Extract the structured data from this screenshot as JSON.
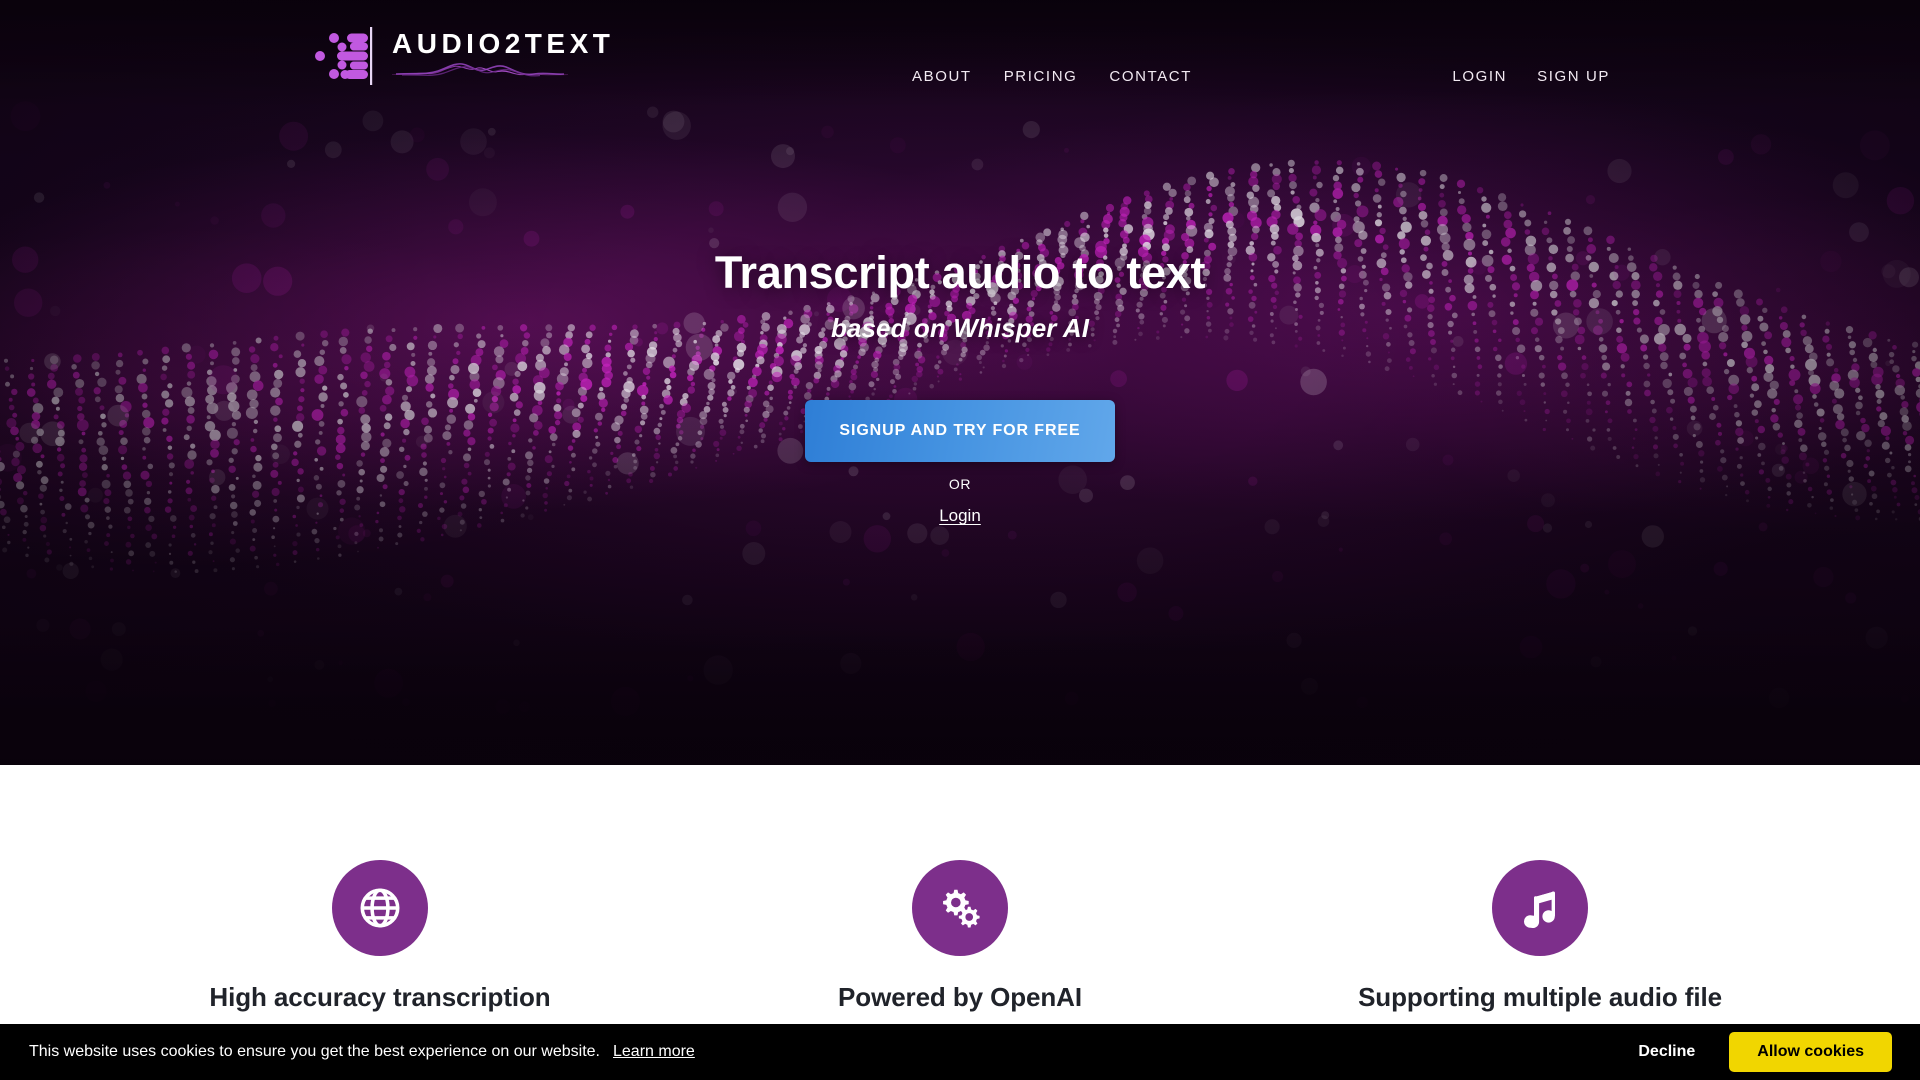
{
  "brand": {
    "name": "AUDIO2TEXT",
    "mark_icon": "audio-waveform-bars-logo",
    "wave_icon": "soundwave-underline"
  },
  "header": {
    "nav": [
      {
        "label": "ABOUT",
        "name": "nav-link-about"
      },
      {
        "label": "PRICING",
        "name": "nav-link-pricing"
      },
      {
        "label": "CONTACT",
        "name": "nav-link-contact"
      }
    ],
    "auth": [
      {
        "label": "LOGIN",
        "name": "nav-link-login"
      },
      {
        "label": "SIGN UP",
        "name": "nav-link-signup"
      }
    ]
  },
  "hero": {
    "title": "Transcript audio to text",
    "subtitle": "based on Whisper AI",
    "cta_label": "SIGNUP AND TRY FOR FREE",
    "or_label": "OR",
    "login_label": "Login",
    "background": "particle-wave-animation"
  },
  "features": [
    {
      "icon": "globe-icon",
      "title": "High accuracy transcription",
      "name": "feature-high-accuracy"
    },
    {
      "icon": "gears-icon",
      "title": "Powered by OpenAI",
      "name": "feature-openai"
    },
    {
      "icon": "music-note-icon",
      "title": "Supporting multiple audio file",
      "name": "feature-audio-formats"
    }
  ],
  "cookie": {
    "message": "This website uses cookies to ensure you get the best experience on our website.",
    "learn_more": "Learn more",
    "decline": "Decline",
    "allow": "Allow cookies"
  },
  "colors": {
    "hero_bg": "#120411",
    "accent_purple": "#7d2f8b",
    "magenta_particle": "#b51fb0",
    "cta_blue_start": "#2e7ed6",
    "cta_blue_end": "#61a7ea",
    "cookie_yellow": "#f1d600",
    "text_dark": "#20232a"
  }
}
